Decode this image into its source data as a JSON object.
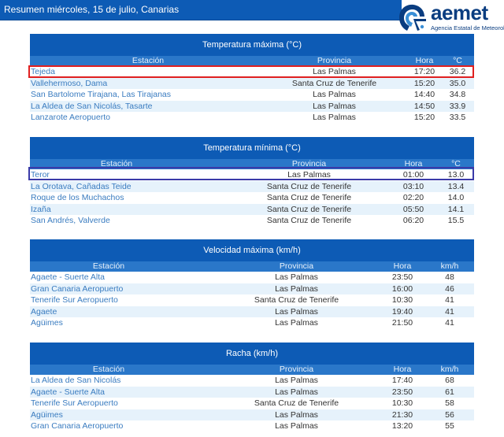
{
  "header": {
    "title": "Resumen miércoles, 15 de julio, Canarias",
    "logo_word": "aemet",
    "logo_sub": "Agencia Estatal de Meteorología",
    "colors": {
      "bar": "#0d5bb5",
      "subhead": "#2a77c9",
      "alt_row": "#e6f2fb",
      "link": "#3a7cc0",
      "highlight_red": "#e02020",
      "highlight_blue": "#3a3aa8"
    }
  },
  "tmax": {
    "title": "Temperatura máxima (°C)",
    "headers": [
      "Estación",
      "Provincia",
      "Hora",
      "°C"
    ],
    "rows": [
      [
        "Tejeda",
        "Las Palmas",
        "17:20",
        "36.2"
      ],
      [
        "Vallehermoso, Dama",
        "Santa Cruz de Tenerife",
        "15:20",
        "35.0"
      ],
      [
        "San Bartolome Tirajana, Las Tirajanas",
        "Las Palmas",
        "14:40",
        "34.8"
      ],
      [
        "La Aldea de San Nicolás, Tasarte",
        "Las Palmas",
        "14:50",
        "33.9"
      ],
      [
        "Lanzarote Aeropuerto",
        "Las Palmas",
        "15:20",
        "33.5"
      ]
    ]
  },
  "tmin": {
    "title": "Temperatura mínima (°C)",
    "headers": [
      "Estación",
      "Provincia",
      "Hora",
      "°C"
    ],
    "rows": [
      [
        "Teror",
        "Las Palmas",
        "01:00",
        "13.0"
      ],
      [
        "La Orotava, Cañadas Teide",
        "Santa Cruz de Tenerife",
        "03:10",
        "13.4"
      ],
      [
        "Roque de los Muchachos",
        "Santa Cruz de Tenerife",
        "02:20",
        "14.0"
      ],
      [
        "Izaña",
        "Santa Cruz de Tenerife",
        "05:50",
        "14.1"
      ],
      [
        "San Andrés, Valverde",
        "Santa Cruz de Tenerife",
        "06:20",
        "15.5"
      ]
    ]
  },
  "wind": {
    "title": "Velocidad máxima (km/h)",
    "headers": [
      "Estación",
      "Provincia",
      "Hora",
      "km/h"
    ],
    "rows": [
      [
        "Agaete - Suerte Alta",
        "Las Palmas",
        "23:50",
        "48"
      ],
      [
        "Gran Canaria Aeropuerto",
        "Las Palmas",
        "16:00",
        "46"
      ],
      [
        "Tenerife Sur Aeropuerto",
        "Santa Cruz de Tenerife",
        "10:30",
        "41"
      ],
      [
        "Agaete",
        "Las Palmas",
        "19:40",
        "41"
      ],
      [
        "Agüimes",
        "Las Palmas",
        "21:50",
        "41"
      ]
    ]
  },
  "gust": {
    "title": "Racha (km/h)",
    "headers": [
      "Estación",
      "Provincia",
      "Hora",
      "km/h"
    ],
    "rows": [
      [
        "La Aldea de San Nicolás",
        "Las Palmas",
        "17:40",
        "68"
      ],
      [
        "Agaete - Suerte Alta",
        "Las Palmas",
        "23:50",
        "61"
      ],
      [
        "Tenerife Sur Aeropuerto",
        "Santa Cruz de Tenerife",
        "10:30",
        "58"
      ],
      [
        "Agüimes",
        "Las Palmas",
        "21:30",
        "56"
      ],
      [
        "Gran Canaria Aeropuerto",
        "Las Palmas",
        "13:20",
        "55"
      ]
    ]
  }
}
